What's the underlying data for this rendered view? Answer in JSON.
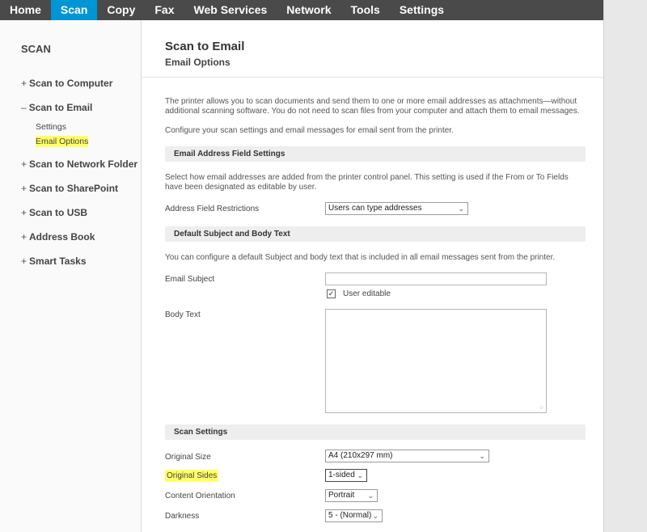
{
  "topnav": {
    "tabs": [
      "Home",
      "Scan",
      "Copy",
      "Fax",
      "Web Services",
      "Network",
      "Tools",
      "Settings"
    ],
    "active": "Scan"
  },
  "sidebar": {
    "title": "SCAN",
    "items": [
      {
        "label": "Scan to Computer",
        "prefix": "+"
      },
      {
        "label": "Scan to Email",
        "prefix": "–"
      },
      {
        "label": "Scan to Network Folder",
        "prefix": "+"
      },
      {
        "label": "Scan to SharePoint",
        "prefix": "+"
      },
      {
        "label": "Scan to USB",
        "prefix": "+"
      },
      {
        "label": "Address Book",
        "prefix": "+"
      },
      {
        "label": "Smart Tasks",
        "prefix": "+"
      }
    ],
    "email_subitems": [
      "Settings",
      "Email Options"
    ]
  },
  "page": {
    "title": "Scan to Email",
    "subtitle": "Email Options",
    "intro_1": "The printer allows you to scan documents and send them to one or more email addresses as attachments—without additional scanning software. You do not need to scan files from your computer and attach them to email messages.",
    "intro_2": "Configure your scan settings and email messages for email sent from the printer."
  },
  "address_section": {
    "heading": "Email Address Field Settings",
    "desc": "Select how email addresses are added from the printer control panel. This setting is used if the From or To Fields have been designated as editable by user.",
    "restriction_label": "Address Field Restrictions",
    "restriction_value": "Users can type addresses"
  },
  "subject_section": {
    "heading": "Default Subject and Body Text",
    "desc": "You can configure a default Subject and body text that is included in all email messages sent from the printer.",
    "subject_label": "Email Subject",
    "subject_value": "",
    "user_editable_label": "User editable",
    "user_editable_checked": true,
    "body_label": "Body Text",
    "body_value": ""
  },
  "scan_settings": {
    "heading": "Scan Settings",
    "original_size_label": "Original Size",
    "original_size_value": "A4 (210x297 mm)",
    "original_sides_label": "Original Sides",
    "original_sides_value": "1-sided",
    "orientation_label": "Content Orientation",
    "orientation_value": "Portrait",
    "darkness_label": "Darkness",
    "darkness_value": "5 - (Normal)"
  },
  "colors": {
    "nav_bg": "#4a4a4a",
    "active_tab": "#0096d6",
    "highlight": "#ffff66"
  }
}
